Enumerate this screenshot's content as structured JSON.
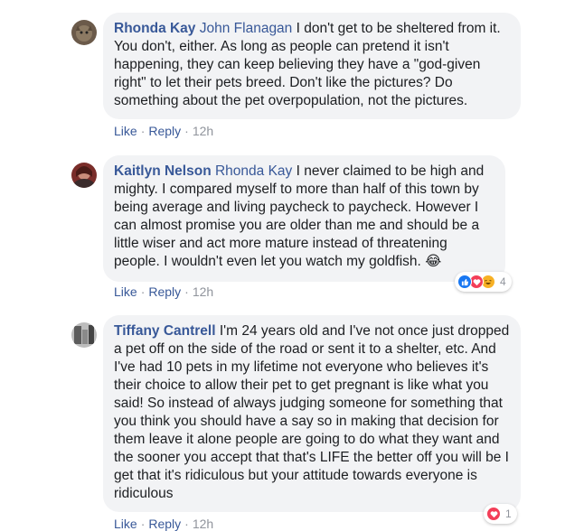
{
  "comments": [
    {
      "author": "Rhonda Kay",
      "mention": "John Flanagan",
      "text": " I don't get to be sheltered from it. You don't, either. As long as people can pretend it isn't happening, they can keep believing they have a \"god-given right\" to let their pets breed. Don't like the pictures? Do something about the pet overpopulation, not the pictures.",
      "like_label": "Like",
      "reply_label": "Reply",
      "time": "12h"
    },
    {
      "author": "Kaitlyn Nelson",
      "mention": "Rhonda Kay",
      "text": " I never claimed to be high and mighty. I compared myself to more than half of this town by being average and living paycheck to paycheck. However I can almost promise you are older than me and should be a little wiser and act more mature instead of threatening people. I wouldn't even let you watch my goldfish. 😂",
      "like_label": "Like",
      "reply_label": "Reply",
      "time": "12h",
      "reaction_count": "4",
      "reaction_icons": [
        "like-icon",
        "love-icon",
        "haha-icon"
      ]
    },
    {
      "author": "Tiffany Cantrell",
      "text": " I'm 24 years old and I've not once just dropped a pet off on the side of the road or sent it to a shelter, etc. And I've had 10 pets in my lifetime not everyone who believes it's their choice to allow their pet to get pregnant is like what you said! So instead of always judging someone for something that you think you should have a say so in making that decision for them leave it alone people are going to do what they want and the sooner you accept that that's LIFE the better off you will be I get that it's ridiculous but your attitude towards everyone is ridiculous",
      "like_label": "Like",
      "reply_label": "Reply",
      "time": "12h",
      "reaction_count": "1",
      "reaction_icons": [
        "love-icon"
      ]
    }
  ],
  "separator": "·"
}
